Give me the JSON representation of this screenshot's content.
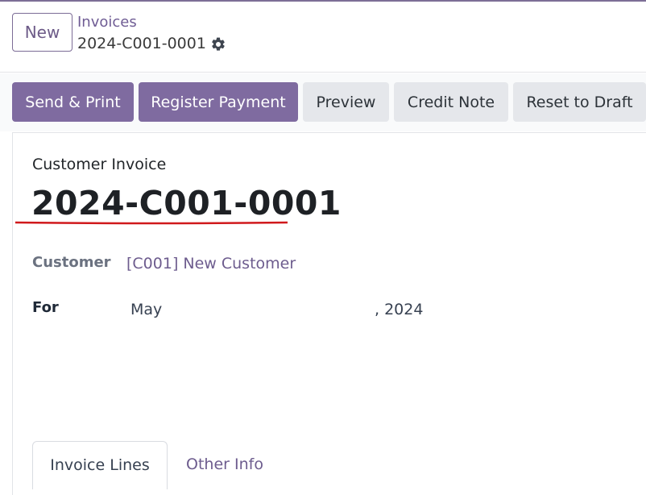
{
  "control_panel": {
    "new_label": "New",
    "breadcrumb_parent": "Invoices",
    "breadcrumb_current": "2024-C001-0001",
    "gear_icon": "gear-icon"
  },
  "statusbar": {
    "buttons": [
      {
        "label": "Send & Print",
        "style": "primary"
      },
      {
        "label": "Register Payment",
        "style": "primary"
      },
      {
        "label": "Preview",
        "style": "secondary"
      },
      {
        "label": "Credit Note",
        "style": "secondary"
      },
      {
        "label": "Reset to Draft",
        "style": "secondary"
      }
    ]
  },
  "form": {
    "document_type": "Customer Invoice",
    "document_name": "2024-C001-0001",
    "customer_label": "Customer",
    "customer_value": "[C001] New Customer",
    "for_label": "For",
    "for_month": "May",
    "for_year": ", 2024"
  },
  "tabs": [
    {
      "label": "Invoice Lines",
      "active": true
    },
    {
      "label": "Other Info",
      "active": false
    }
  ],
  "colors": {
    "primary": "#7f6ba0",
    "link": "#6f5c94",
    "underline_annotation": "#d0191c"
  }
}
